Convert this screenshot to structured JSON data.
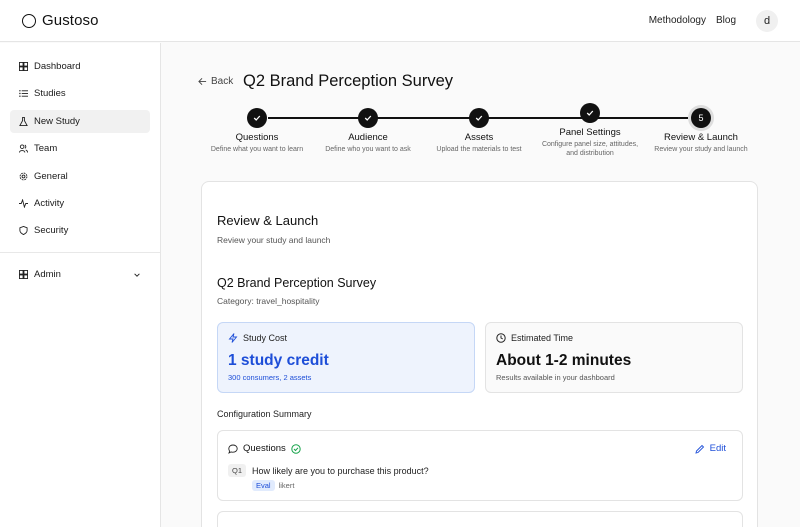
{
  "app": {
    "name": "Gustoso"
  },
  "topnav": {
    "methodology": "Methodology",
    "blog": "Blog",
    "avatar": "d"
  },
  "sidebar": {
    "items": [
      {
        "label": "Dashboard",
        "icon": "dashboard-icon"
      },
      {
        "label": "Studies",
        "icon": "list-icon"
      },
      {
        "label": "New Study",
        "icon": "flask-icon",
        "active": true
      },
      {
        "label": "Team",
        "icon": "users-icon"
      },
      {
        "label": "General",
        "icon": "gear-icon"
      },
      {
        "label": "Activity",
        "icon": "activity-icon"
      },
      {
        "label": "Security",
        "icon": "shield-icon"
      }
    ],
    "admin": {
      "label": "Admin",
      "icon": "admin-icon"
    }
  },
  "page": {
    "back": "Back",
    "title": "Q2 Brand Perception Survey"
  },
  "stepper": {
    "steps": [
      {
        "label": "Questions",
        "desc": "Define what you want to learn",
        "state": "done"
      },
      {
        "label": "Audience",
        "desc": "Define who you want to ask",
        "state": "done"
      },
      {
        "label": "Assets",
        "desc": "Upload the materials to test",
        "state": "done"
      },
      {
        "label": "Panel Settings",
        "desc": "Configure panel size, attitudes, and distribution",
        "state": "done"
      },
      {
        "label": "Review & Launch",
        "desc": "Review your study and launch",
        "state": "current",
        "number": "5"
      }
    ]
  },
  "review": {
    "heading": "Review & Launch",
    "subheading": "Review your study and launch",
    "study_title": "Q2 Brand Perception Survey",
    "category": "Category: travel_hospitality",
    "cost": {
      "label": "Study Cost",
      "value": "1 study credit",
      "detail": "300 consumers, 2 assets"
    },
    "time": {
      "label": "Estimated Time",
      "value": "About 1-2 minutes",
      "detail": "Results available in your dashboard"
    },
    "config_title": "Configuration Summary",
    "questions": {
      "label": "Questions",
      "edit": "Edit",
      "items": [
        {
          "tag": "Q1",
          "text": "How likely are you to purchase this product?",
          "badge": "Eval",
          "type": "likert"
        }
      ]
    }
  },
  "colors": {
    "accent": "#1d4ed8",
    "cost_bg": "#eef3fd",
    "success": "#16a34a"
  }
}
